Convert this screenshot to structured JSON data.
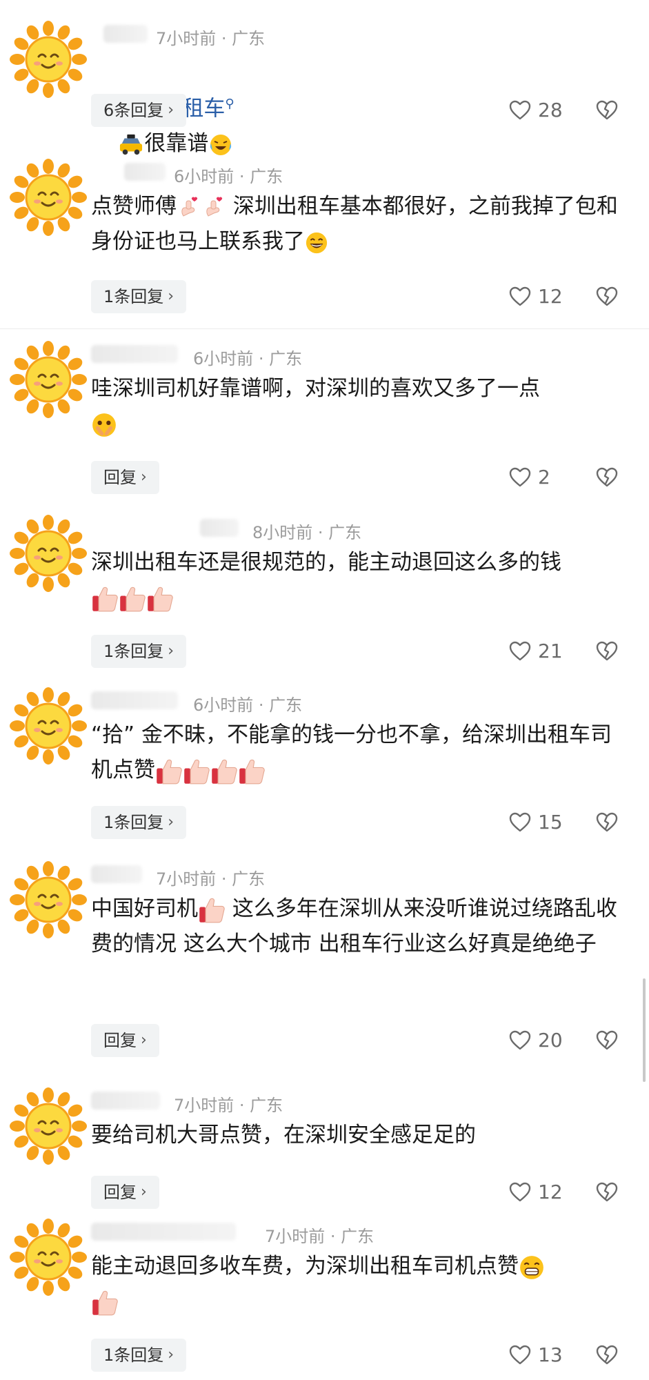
{
  "comments": [
    {
      "meta": "7小时前 · 广东",
      "text_link": "深圳出租车",
      "text": "很靠谱",
      "reply_label": "6条回复",
      "likes": "28"
    },
    {
      "meta": "6小时前 · 广东",
      "text_a": "点赞师傅",
      "text_b": "深圳出租车基本都很好，之前我掉了包和身份证也马上联系我了",
      "reply_label": "1条回复",
      "likes": "12"
    },
    {
      "meta": "6小时前 · 广东",
      "text": "哇深圳司机好靠谱啊，对深圳的喜欢又多了一点",
      "reply_label": "回复",
      "likes": "2"
    },
    {
      "meta": "8小时前 · 广东",
      "text": "深圳出租车还是很规范的，能主动退回这么多的钱",
      "reply_label": "1条回复",
      "likes": "21"
    },
    {
      "meta": "6小时前 · 广东",
      "text": "“拾” 金不昧，不能拿的钱一分也不拿，给深圳出租车司机点赞",
      "reply_label": "1条回复",
      "likes": "15"
    },
    {
      "meta": "7小时前 · 广东",
      "text_a": "中国好司机",
      "text_b": "这么多年在深圳从来没听谁说过绕路乱收费的情况 这么大个城市 出租车行业这么好真是绝绝子",
      "reply_label": "回复",
      "likes": "20"
    },
    {
      "meta": "7小时前 · 广东",
      "text": "要给司机大哥点赞，在深圳安全感足足的",
      "reply_label": "回复",
      "likes": "12"
    },
    {
      "meta": "7小时前 · 广东",
      "text": "能主动退回多收车费，为深圳出租车司机点赞",
      "reply_label": "1条回复",
      "likes": "13"
    }
  ],
  "icons": {
    "avatar": "sun-avatar-icon",
    "like": "heart-outline-icon",
    "dislike": "broken-heart-icon",
    "search": "search-icon",
    "reply_chevron": "chevron-right-icon"
  },
  "colors": {
    "link": "#2b5fa8",
    "meta": "#9b9b9b",
    "reply_bg": "#f1f3f4"
  }
}
